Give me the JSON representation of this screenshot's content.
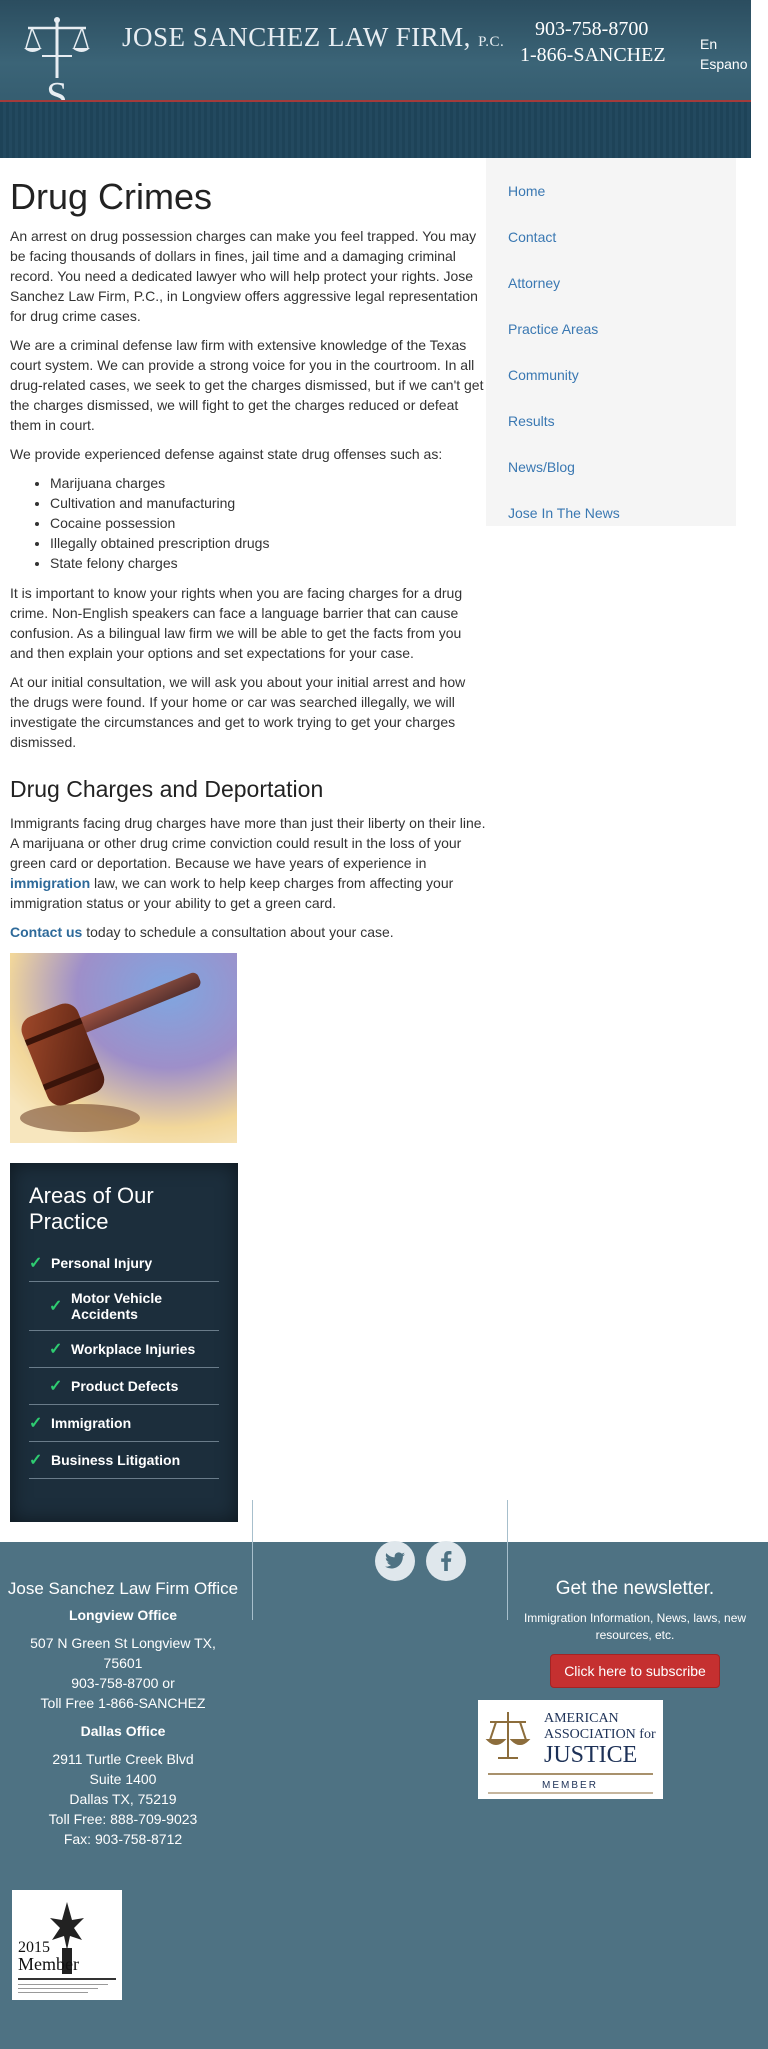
{
  "header": {
    "firm_name": "JOSE SANCHEZ LAW FIRM",
    "firm_suffix": "P.C.",
    "phone_local": "903-758-8700",
    "phone_tollfree": "1-866-SANCHEZ",
    "lang_en": "En",
    "lang_es": "Espano"
  },
  "nav": {
    "items": [
      "Home",
      "Contact",
      "Attorney",
      "Practice Areas",
      "Community",
      "Results",
      "News/Blog",
      "Jose In The News"
    ]
  },
  "main": {
    "title": "Drug Crimes",
    "p1": "An arrest on drug possession charges can make you feel trapped. You may be facing thousands of dollars in fines, jail time and a damaging criminal record. You need a dedicated lawyer who will help protect your rights. Jose Sanchez Law Firm, P.C., in Longview offers aggressive legal representation for drug crime cases.",
    "p2": "We are a criminal defense law firm with extensive knowledge of the Texas court system. We can provide a strong voice for you in the courtroom. In all drug-related cases, we seek to get the charges dismissed, but if we can't get the charges dismissed, we will fight to get the charges reduced or defeat them in court.",
    "p3": "We provide experienced defense against state drug offenses such as:",
    "charges": [
      "Marijuana charges",
      "Cultivation and manufacturing",
      "Cocaine possession",
      "Illegally obtained prescription drugs",
      "State felony charges"
    ],
    "p4": "It is important to know your rights when you are facing charges for a drug crime. Non-English speakers can face a language barrier that can cause confusion. As a bilingual law firm we will be able to get the facts from you and then explain your options and set expectations for your case.",
    "p5": "At our initial consultation, we will ask you about your initial arrest and how the drugs were found. If your home or car was searched illegally, we will investigate the circumstances and get to work trying to get your charges dismissed.",
    "subtitle": "Drug Charges and Deportation",
    "p6_before": "Immigrants facing drug charges have more than just their liberty on their line. A marijuana or other drug crime conviction could result in the loss of your green card or deportation. Because we have years of experience in ",
    "p6_link": "immigration",
    "p6_after": " law, we can work to help keep charges from affecting your immigration status or your ability to get a green card.",
    "p7_link": "Contact us",
    "p7_after": " today to schedule a consultation about your case."
  },
  "practice": {
    "title": "Areas of Our Practice",
    "items": [
      {
        "label": "Personal Injury",
        "sub": false
      },
      {
        "label": "Motor Vehicle Accidents",
        "sub": true
      },
      {
        "label": "Workplace Injuries",
        "sub": true
      },
      {
        "label": "Product Defects",
        "sub": true
      },
      {
        "label": "Immigration",
        "sub": false
      },
      {
        "label": "Business Litigation",
        "sub": false
      }
    ]
  },
  "footer": {
    "firm": "Jose Sanchez Law Firm Office",
    "longview_title": "Longview Office",
    "longview_lines": [
      "507 N Green St Longview TX,",
      "75601",
      "903-758-8700 or",
      "Toll Free 1-866-SANCHEZ"
    ],
    "dallas_title": "Dallas Office",
    "dallas_lines": [
      "2911 Turtle Creek Blvd",
      "Suite 1400",
      "Dallas TX, 75219",
      "Toll Free: 888-709-9023",
      "Fax: 903-758-8712"
    ],
    "newsletter_title": "Get the newsletter.",
    "newsletter_sub": "Immigration Information, News, laws, new resources, etc.",
    "subscribe_label": "Click here to subscribe",
    "aaj_line1": "AMERICAN",
    "aaj_line2": "ASSOCIATION for",
    "aaj_line3": "JUSTICE",
    "aaj_member": "MEMBER",
    "badge_year": "2015",
    "badge_member": "Member"
  }
}
